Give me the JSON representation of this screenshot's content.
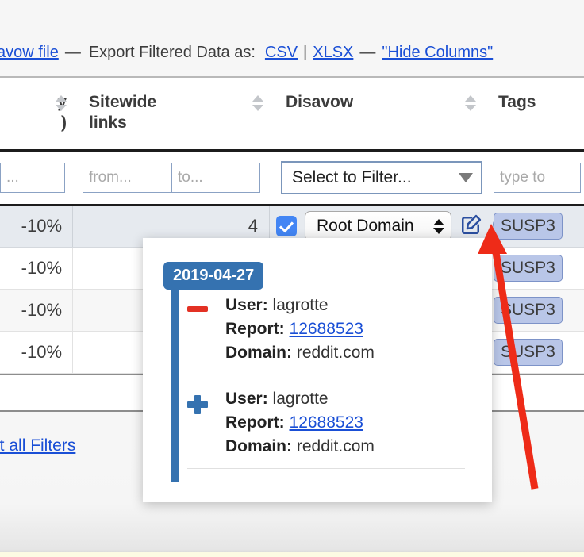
{
  "toolbar": {
    "file_link": "savow file",
    "dash1": "—",
    "export_label": "Export Filtered Data as:",
    "csv": "CSV",
    "pipe": "|",
    "xlsx": "XLSX",
    "dash2": "—",
    "hide_columns": "\"Hide Columns\""
  },
  "table": {
    "headers": [
      {
        "label": "y\n)",
        "line1": "y",
        "line2": ")",
        "sortable": false
      },
      {
        "label": "Sitewide links",
        "line1": "Sitewide",
        "line2": "links",
        "sortable": true
      },
      {
        "label": "Disavow",
        "line1": "Disavow",
        "line2": "",
        "sortable": true
      },
      {
        "label": "Tags",
        "line1": "Tags",
        "line2": "",
        "sortable": true
      }
    ],
    "filters": {
      "col0_placeholder": "...",
      "from_placeholder": "from...",
      "to_placeholder": "to...",
      "disavow_select_value": "Select to Filter...",
      "tags_placeholder": "type to"
    },
    "rows": [
      {
        "percent": "-10%",
        "sitewide_links": "4",
        "checked": true,
        "disavow_scope": "Root Domain",
        "tag": "SUSP3",
        "selected": true
      },
      {
        "percent": "-10%",
        "sitewide_links": "",
        "checked": false,
        "disavow_scope": "",
        "tag": "SUSP3",
        "selected": false
      },
      {
        "percent": "-10%",
        "sitewide_links": "",
        "checked": false,
        "disavow_scope": "",
        "tag": "SUSP3",
        "selected": false
      },
      {
        "percent": "-10%",
        "sitewide_links": "",
        "checked": false,
        "disavow_scope": "",
        "tag": "SUSP3",
        "selected": false
      }
    ]
  },
  "reset_filters_link": "et all Filters",
  "popup": {
    "date": "2019-04-27",
    "entries": [
      {
        "type": "removed",
        "marker": "minus-icon",
        "user_label": "User:",
        "user_value": "lagrotte",
        "report_label": "Report:",
        "report_value": "12688523",
        "domain_label": "Domain:",
        "domain_value": "reddit.com"
      },
      {
        "type": "added",
        "marker": "plus-icon",
        "user_label": "User:",
        "user_value": "lagrotte",
        "report_label": "Report:",
        "report_value": "12688523",
        "domain_label": "Domain:",
        "domain_value": "reddit.com"
      }
    ]
  },
  "colors": {
    "link": "#1a4fd6",
    "checkbox": "#4285f4",
    "timeline": "#3572b0",
    "icon": "#2b4fa0",
    "tag_bg": "#b9c6e8",
    "minus": "#e33124",
    "annotation_arrow": "#ee2b18"
  }
}
